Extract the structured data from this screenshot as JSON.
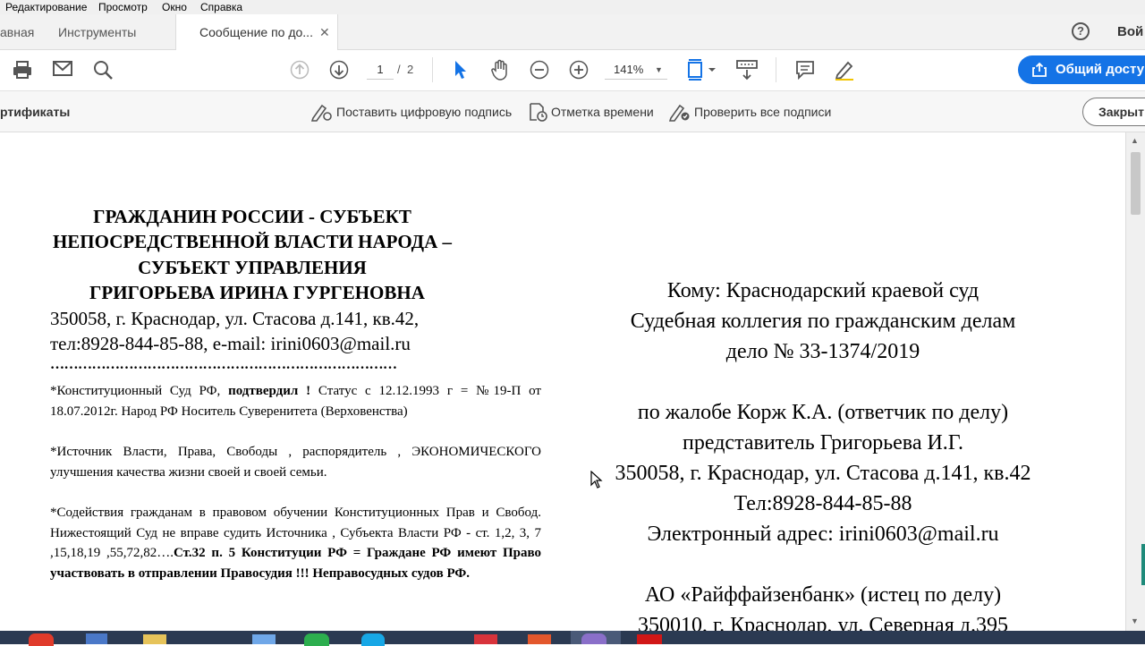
{
  "menu": [
    "Редактирование",
    "Просмотр",
    "Окно",
    "Справка"
  ],
  "tabs": {
    "home": "авная",
    "tools": "Инструменты",
    "document": "Сообщение по до...",
    "help_icon": "question-icon",
    "signin": "Вой"
  },
  "toolbar": {
    "page_current": "1",
    "page_sep": "/",
    "page_total": "2",
    "zoom": "141%",
    "share_button": "Общий досту",
    "accent": "#1473e6"
  },
  "sigbar": {
    "title": "ртификаты",
    "sign": "Поставить цифровую подпись",
    "timestamp": "Отметка времени",
    "verify": "Проверить все подписи",
    "close": "Закрыт"
  },
  "document": {
    "header_lines": [
      "ГРАЖДАНИН РОССИИ - СУБЪЕКТ",
      "НЕПОСРЕДСТВЕННОЙ ВЛАСТИ НАРОДА –",
      "СУБЪЕКТ УПРАВЛЕНИЯ",
      "ГРИГОРЬЕВА ИРИНА ГУРГЕНОВНА"
    ],
    "address": "350058, г. Краснодар, ул. Стасова д.141, кв.42,",
    "contact": "тел:8928-844-85-88, e-mail: irini0603@mail.ru",
    "dots": "…………………………………………………………………",
    "p1_a": "*Конституционный Суд РФ, ",
    "p1_bold": "подтвердил !",
    "p1_b": " Статус с 12.12.1993 г = №19-П от 18.07.2012г. Народ РФ Носитель Суверенитета (Верховенства)",
    "p2": "*Источник Власти, Права, Свободы , распорядитель , ЭКОНОМИЧЕСКОГО улучшения качества жизни своей и своей семьи.",
    "p3_a": "*Содействия гражданам в правовом обучении Конституционных Прав и Свобод. Нижестоящий Суд не вправе судить Источника , Субъекта Власти РФ - ст. 1,2, 3, 7 ,15,18,19 ,55,72,82….",
    "p3_bold": "Ст.32 п. 5 Конституции РФ = Граждане РФ имеют Право участвовать в отправлении Правосудия !!! Неправосудных судов РФ.",
    "right_lines": [
      "Кому: Краснодарский  краевой суд",
      "Судебная коллегия по гражданским делам",
      "дело № 33-1374/2019",
      "",
      "по жалобе Корж К.А. (ответчик по делу)",
      "представитель Григорьева И.Г.",
      "350058, г. Краснодар, ул. Стасова д.141, кв.42",
      "Тел:8928-844-85-88",
      "Электронный адрес: irini0603@mail.ru",
      "",
      "АО «Райффайзенбанк» (истец по делу)",
      "350010, г. Краснодар, ул. Северная д.395"
    ]
  }
}
